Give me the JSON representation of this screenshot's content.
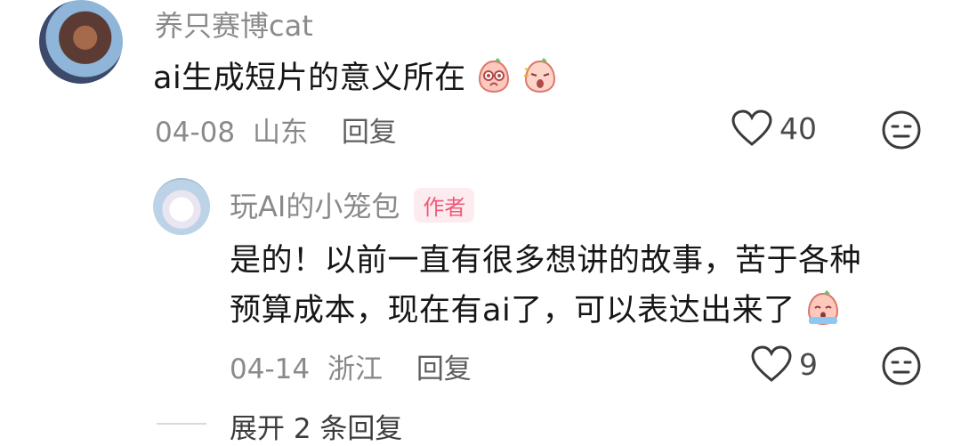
{
  "comment": {
    "username": "养只赛博cat",
    "text": "ai生成短片的意义所在",
    "emojis": [
      "blushing-peach-emoji",
      "surprised-peach-emoji"
    ],
    "date": "04-08",
    "location": "山东",
    "reply_label": "回复",
    "likes": "40"
  },
  "reply": {
    "username": "玩AI的小笼包",
    "badge": "作者",
    "text_line1": "是的！以前一直有很多想讲的故事，苦于各种",
    "text_line2": "预算成本，现在有ai了，可以表达出来了",
    "emoji": "crying-peach-emoji",
    "date": "04-14",
    "location": "浙江",
    "reply_label": "回复",
    "likes": "9"
  },
  "expand_label": "展开 2 条回复",
  "colors": {
    "badge_bg": "#fdecef",
    "badge_text": "#ee5a79",
    "meta": "#8a8a8a"
  }
}
